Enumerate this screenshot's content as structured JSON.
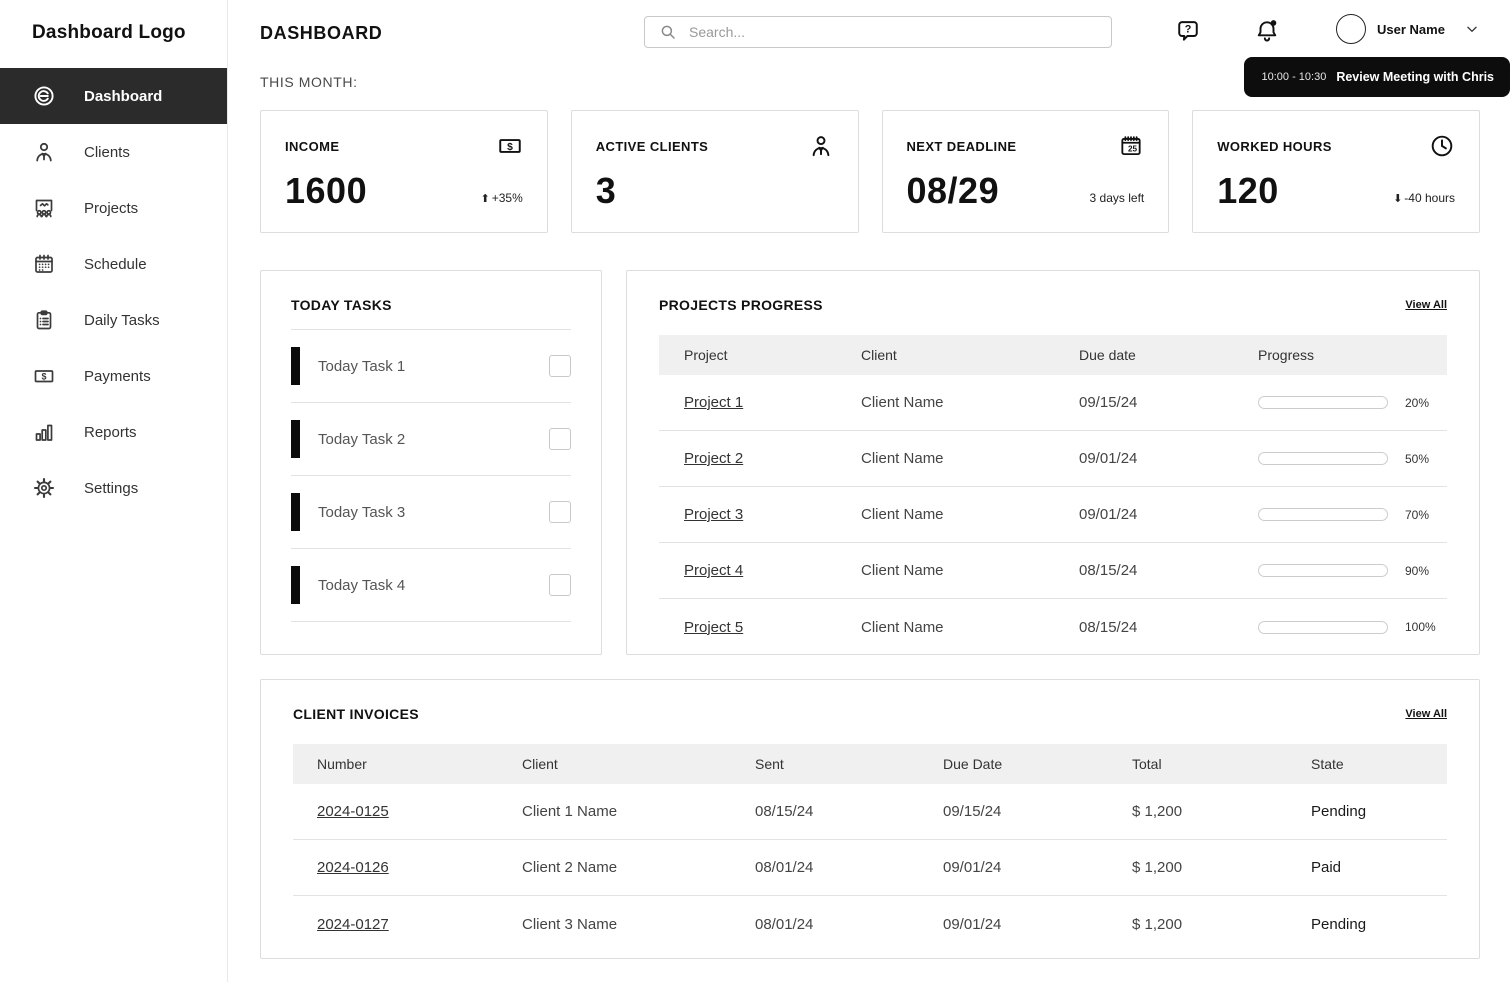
{
  "sidebar": {
    "logo": "Dashboard Logo",
    "items": [
      {
        "label": "Dashboard",
        "icon": "dashboard-icon",
        "active": true
      },
      {
        "label": "Clients",
        "icon": "clients-icon",
        "active": false
      },
      {
        "label": "Projects",
        "icon": "projects-icon",
        "active": false
      },
      {
        "label": "Schedule",
        "icon": "schedule-icon",
        "active": false
      },
      {
        "label": "Daily Tasks",
        "icon": "daily-tasks-icon",
        "active": false
      },
      {
        "label": "Payments",
        "icon": "payments-icon",
        "active": false
      },
      {
        "label": "Reports",
        "icon": "reports-icon",
        "active": false
      },
      {
        "label": "Settings",
        "icon": "settings-icon",
        "active": false
      }
    ]
  },
  "header": {
    "title": "DASHBOARD",
    "search_placeholder": "Search...",
    "user_name": "User Name"
  },
  "toast": {
    "time": "10:00 - 10:30",
    "text": "Review Meeting with Chris"
  },
  "this_month_label": "THIS MONTH:",
  "stats": [
    {
      "label": "INCOME",
      "value": "1600",
      "trend_arrow": "⬆",
      "sub": "+35%",
      "icon": "money-icon"
    },
    {
      "label": "ACTIVE CLIENTS",
      "value": "3",
      "trend_arrow": "",
      "sub": "",
      "icon": "client-icon"
    },
    {
      "label": "NEXT DEADLINE",
      "value": "08/29",
      "trend_arrow": "",
      "sub": "3 days left",
      "icon": "calendar-25-icon"
    },
    {
      "label": "WORKED HOURS",
      "value": "120",
      "trend_arrow": "⬇",
      "sub": "-40 hours",
      "icon": "clock-icon"
    }
  ],
  "today_tasks": {
    "title": "TODAY TASKS",
    "tasks": [
      {
        "label": "Today Task 1",
        "checked": false
      },
      {
        "label": "Today Task 2",
        "checked": false
      },
      {
        "label": "Today Task 3",
        "checked": false
      },
      {
        "label": "Today Task 4",
        "checked": false
      }
    ]
  },
  "projects_progress": {
    "title": "PROJECTS PROGRESS",
    "view_all": "View All",
    "columns": {
      "project": "Project",
      "client": "Client",
      "due": "Due date",
      "progress": "Progress"
    },
    "rows": [
      {
        "project": "Project 1",
        "client": "Client Name",
        "due": "09/15/24",
        "progress": 20,
        "progress_label": "20%"
      },
      {
        "project": "Project 2",
        "client": "Client Name",
        "due": "09/01/24",
        "progress": 50,
        "progress_label": "50%"
      },
      {
        "project": "Project 3",
        "client": "Client Name",
        "due": "09/01/24",
        "progress": 70,
        "progress_label": "70%"
      },
      {
        "project": "Project 4",
        "client": "Client Name",
        "due": "08/15/24",
        "progress": 90,
        "progress_label": "90%"
      },
      {
        "project": "Project 5",
        "client": "Client Name",
        "due": "08/15/24",
        "progress": 100,
        "progress_label": "100%"
      }
    ]
  },
  "client_invoices": {
    "title": "CLIENT INVOICES",
    "view_all": "View All",
    "columns": {
      "number": "Number",
      "client": "Client",
      "sent": "Sent",
      "due": "Due Date",
      "total": "Total",
      "state": "State"
    },
    "rows": [
      {
        "number": "2024-0125",
        "client": "Client 1 Name",
        "sent": "08/15/24",
        "due": "09/15/24",
        "total": "$ 1,200",
        "state": "Pending"
      },
      {
        "number": "2024-0126",
        "client": "Client 2 Name",
        "sent": "08/01/24",
        "due": "09/01/24",
        "total": "$ 1,200",
        "state": "Paid"
      },
      {
        "number": "2024-0127",
        "client": "Client 3 Name",
        "sent": "08/01/24",
        "due": "09/01/24",
        "total": "$ 1,200",
        "state": "Pending"
      }
    ]
  },
  "colors": {
    "accent": "#0b0b0b",
    "active_nav_bg": "#2b2b2b",
    "table_header_bg": "#f0f0f0",
    "border": "#dddddd"
  }
}
